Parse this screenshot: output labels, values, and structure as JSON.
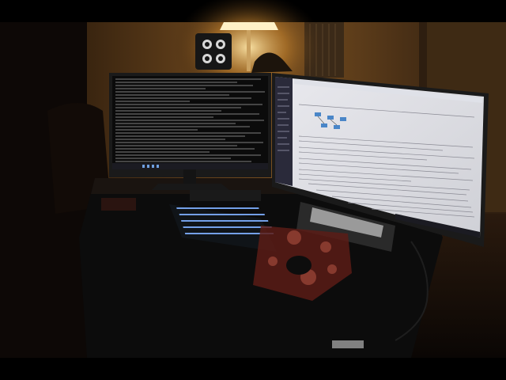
{
  "scene": {
    "description_tags": [
      "desk",
      "dual-monitor",
      "terminal",
      "web-page",
      "keyboard",
      "mouse",
      "desk-lamp",
      "speaker"
    ],
    "colors": {
      "wall": "#3a2410",
      "wall_lit": "#8a5a22",
      "lamp_glow": "#ffd98a",
      "terminal_bg": "#0b0b0b",
      "terminal_text": "#cfcfcf",
      "browser_bg": "#f2f2f4",
      "browser_sidebar": "#2a2a3a",
      "keyboard_backlight": "#7fb0ff",
      "desk": "#0d0d0d",
      "mousepad_red": "#8a2a22"
    }
  }
}
